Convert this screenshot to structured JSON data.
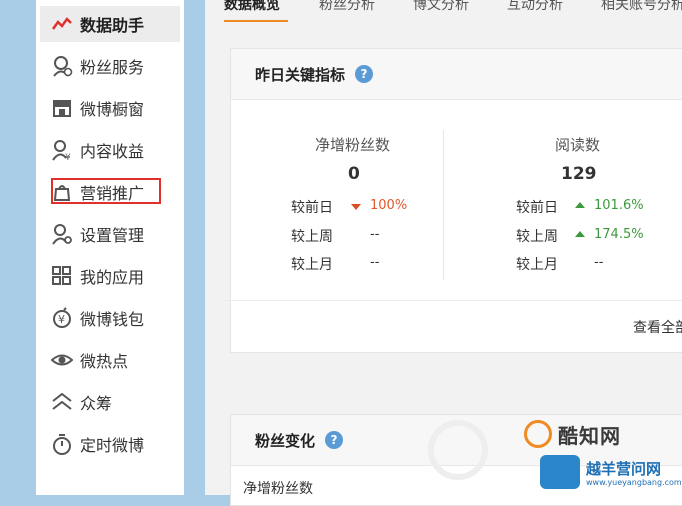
{
  "sidebar": {
    "items": [
      {
        "label": "数据助手",
        "icon": "line-chart-icon",
        "active": true
      },
      {
        "label": "粉丝服务",
        "icon": "fans-service-icon"
      },
      {
        "label": "微博橱窗",
        "icon": "shop-window-icon"
      },
      {
        "label": "内容收益",
        "icon": "content-income-icon"
      },
      {
        "label": "营销推广",
        "icon": "promotion-bag-icon"
      },
      {
        "label": "设置管理",
        "icon": "settings-user-icon"
      },
      {
        "label": "我的应用",
        "icon": "apps-grid-icon"
      },
      {
        "label": "微博钱包",
        "icon": "wallet-icon"
      },
      {
        "label": "微热点",
        "icon": "eye-icon"
      },
      {
        "label": "众筹",
        "icon": "crowdfunding-icon"
      },
      {
        "label": "定时微博",
        "icon": "timer-icon"
      }
    ],
    "accent": "#e0302b"
  },
  "tabs": [
    {
      "label": "数据概览",
      "active": true
    },
    {
      "label": "粉丝分析"
    },
    {
      "label": "博文分析"
    },
    {
      "label": "互动分析"
    },
    {
      "label": "相关账号分析"
    }
  ],
  "yesterday_card": {
    "title": "昨日关键指标",
    "help": "?",
    "metrics": [
      {
        "name": "净增粉丝数",
        "value": "0",
        "comparisons": [
          {
            "label": "较前日",
            "value": "100%",
            "trend": "down"
          },
          {
            "label": "较上周",
            "value": "--"
          },
          {
            "label": "较上月",
            "value": "--"
          }
        ]
      },
      {
        "name": "阅读数",
        "value": "129",
        "comparisons": [
          {
            "label": "较前日",
            "value": "101.6%",
            "trend": "up"
          },
          {
            "label": "较上周",
            "value": "174.5%",
            "trend": "up"
          },
          {
            "label": "较上月",
            "value": "--"
          }
        ]
      }
    ],
    "view_all": "查看全部"
  },
  "fans_card": {
    "title": "粉丝变化",
    "help": "?",
    "row_label": "净增粉丝数"
  },
  "watermark": {
    "brand1": "酷知网",
    "brand2": "越羊营问网",
    "url": "www.yueyangbang.com"
  },
  "colors": {
    "up": "#3c9a3c",
    "down": "#d9502a",
    "tab_accent": "#f08a24"
  }
}
